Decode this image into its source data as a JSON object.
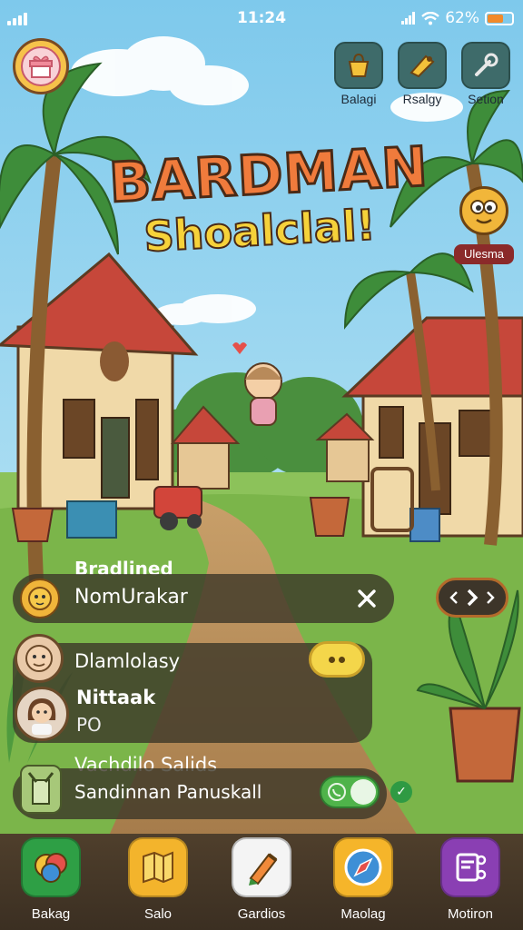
{
  "status_bar": {
    "time": "11:24",
    "battery": "62%",
    "battery_level": 0.62
  },
  "top_icons": [
    {
      "name": "bag",
      "label": "Balagi"
    },
    {
      "name": "horn",
      "label": "Rsalgy"
    },
    {
      "name": "wrench",
      "label": "Setion"
    }
  ],
  "title": {
    "line1": "BARDMAN",
    "line2": "Shoalclal!"
  },
  "side_character": {
    "label": "Ulesma"
  },
  "rows": [
    {
      "heading": "Bradlined",
      "value": "NomUrakar"
    },
    {
      "name": "Dlamlolasy"
    },
    {
      "name": "Nittaak",
      "sub": "PO"
    },
    {
      "name": "Vachdilo Salids",
      "sub": "Sandinnan Panuskall"
    }
  ],
  "dock": [
    {
      "label": "Bakag",
      "icon": "chat-bubbles-icon",
      "color": "#2e9f45"
    },
    {
      "label": "Salo",
      "icon": "map-icon",
      "color": "#f3b42c"
    },
    {
      "label": "Gardios",
      "icon": "pencil-icon",
      "color": "#f4f4f4"
    },
    {
      "label": "Maolag",
      "icon": "compass-icon",
      "color": "#f5b52a"
    },
    {
      "label": "Motiron",
      "icon": "network-icon",
      "color": "#8a3fb3"
    }
  ],
  "colors": {
    "accent": "#f07b3c",
    "panel": "#3c3728",
    "dock": "#4f3f2c"
  }
}
